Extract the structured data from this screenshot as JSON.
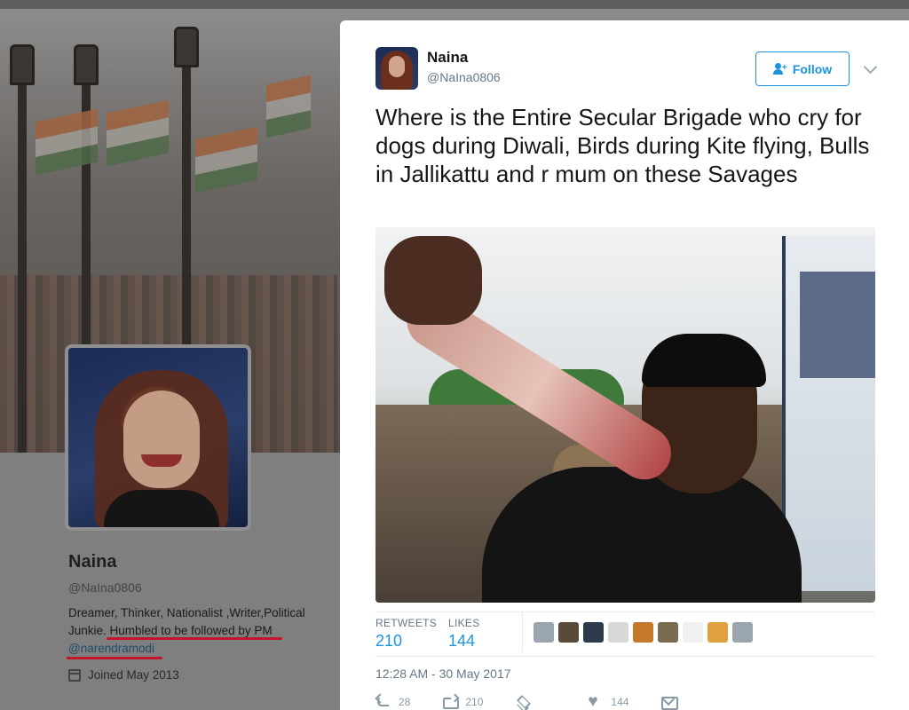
{
  "profile": {
    "name": "Naina",
    "handle": "@NaIna0806",
    "bio_part1": "Dreamer, Thinker, Nationalist ,Writer,Political Junkie. ",
    "bio_part2": "Humbled to be followed by PM",
    "bio_mention": "@narendramodi",
    "joined": "Joined May 2013",
    "annotation_color": "#c4162a"
  },
  "tweet": {
    "author_name": "Naina",
    "author_handle": "@NaIna0806",
    "follow_label": "Follow",
    "text": "Where is the Entire Secular Brigade who cry for dogs during Diwali, Birds during Kite flying, Bulls in Jallikattu and r mum on these Savages",
    "retweets_label": "RETWEETS",
    "retweets_count": "210",
    "likes_label": "LIKES",
    "likes_count": "144",
    "timestamp": "12:28 AM - 30 May 2017",
    "actions": {
      "reply_count": "28",
      "retweet_count": "210",
      "like_count": "144"
    },
    "liker_colors": [
      "#9aa5b0",
      "#5a4a3a",
      "#2c3a4a",
      "#d8d8d8",
      "#c47a2a",
      "#7a6a50",
      "#f0f0f0",
      "#e0a040",
      "#9aa5b0"
    ]
  },
  "colors": {
    "accent": "#1b95e0",
    "muted": "#657786"
  }
}
